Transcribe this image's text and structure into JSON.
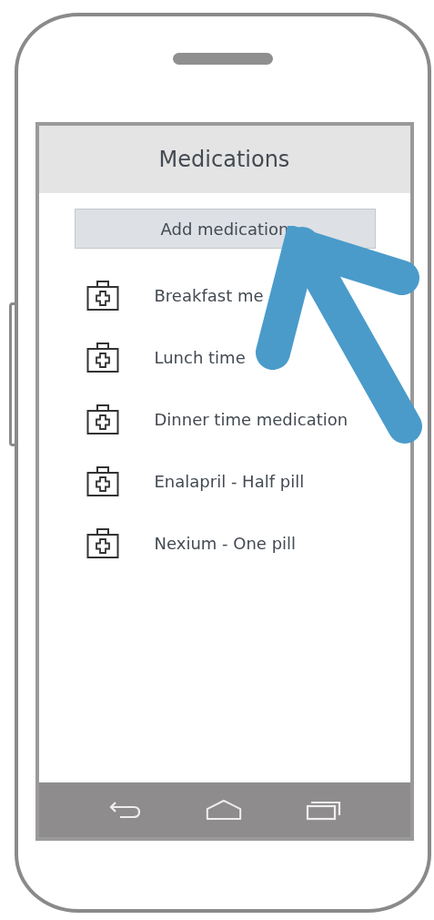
{
  "screen": {
    "title": "Medications"
  },
  "add_button": {
    "label": "Add medication"
  },
  "medications": [
    {
      "label": "Breakfast me"
    },
    {
      "label": "Lunch time"
    },
    {
      "label": "Dinner time medication"
    },
    {
      "label": "Enalapril - Half pill"
    },
    {
      "label": "Nexium - One pill"
    }
  ]
}
